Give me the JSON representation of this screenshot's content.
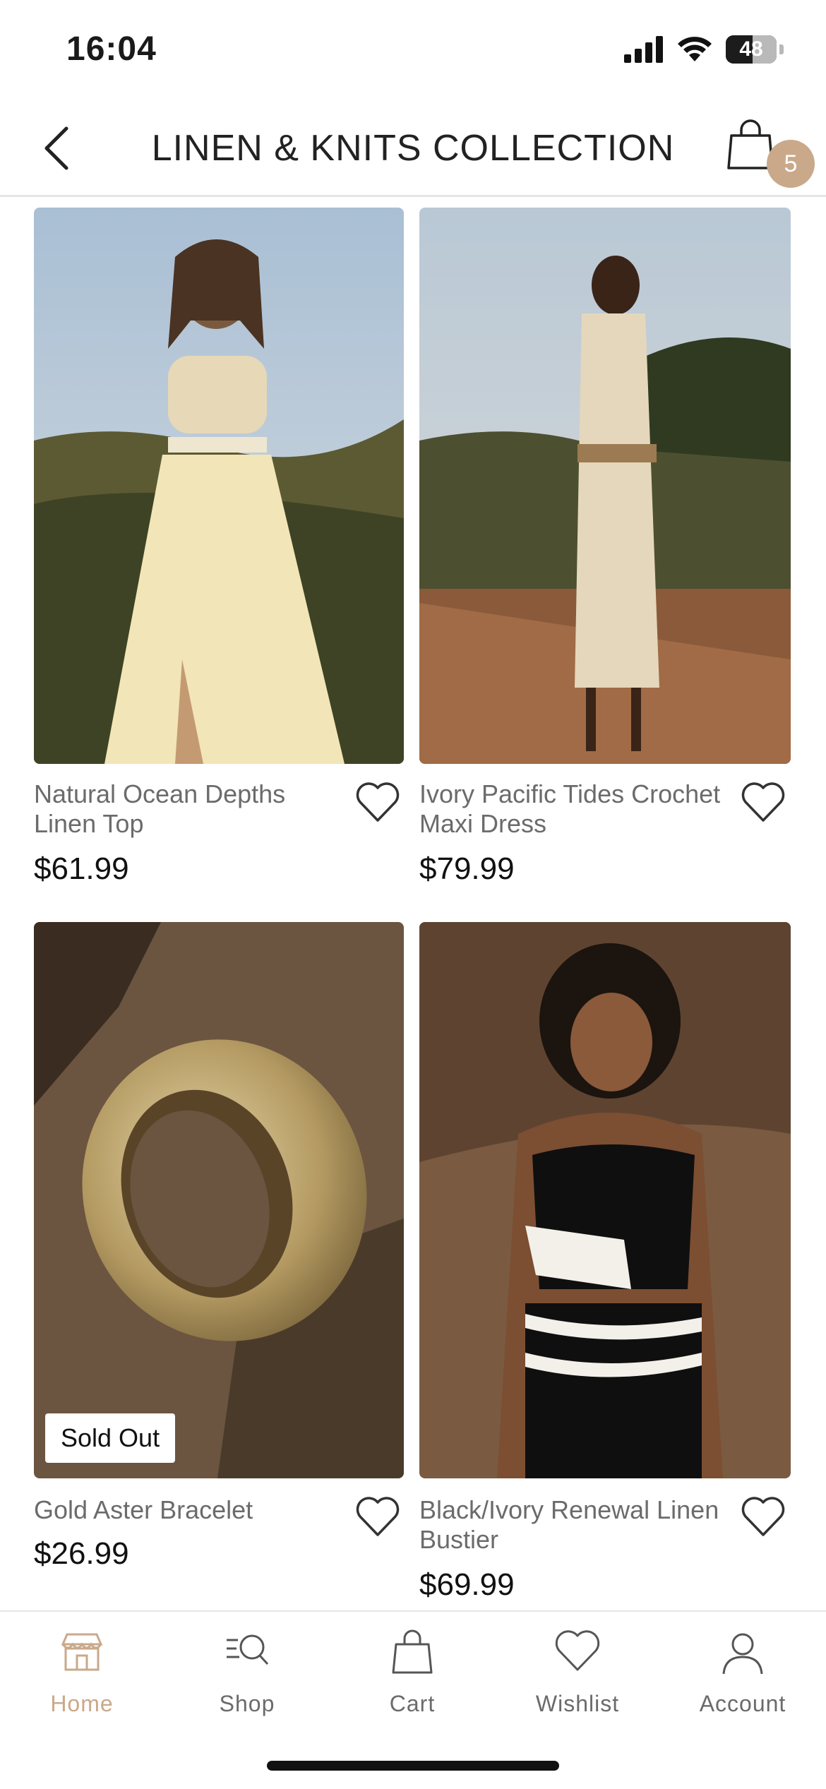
{
  "status_bar": {
    "time": "16:04",
    "battery": "48"
  },
  "header": {
    "title": "LINEN & KNITS COLLECTION",
    "cart_count": "5"
  },
  "products": [
    {
      "name": "Natural Ocean Depths Linen Top",
      "price": "$61.99",
      "badge": ""
    },
    {
      "name": "Ivory Pacific Tides Crochet Maxi Dress",
      "price": "$79.99",
      "badge": ""
    },
    {
      "name": "Gold Aster Bracelet",
      "price": "$26.99",
      "badge": "Sold Out"
    },
    {
      "name": "Black/Ivory Renewal Linen Bustier",
      "price": "$69.99",
      "badge": ""
    }
  ],
  "tabs": [
    {
      "label": "Home",
      "icon": "store-icon",
      "active": true
    },
    {
      "label": "Shop",
      "icon": "search-list-icon",
      "active": false
    },
    {
      "label": "Cart",
      "icon": "bag-icon",
      "active": false
    },
    {
      "label": "Wishlist",
      "icon": "heart-icon",
      "active": false
    },
    {
      "label": "Account",
      "icon": "person-icon",
      "active": false
    }
  ],
  "colors": {
    "accent": "#c9a98a",
    "text": "#1a1a1a",
    "muted": "#6b6b6b"
  }
}
